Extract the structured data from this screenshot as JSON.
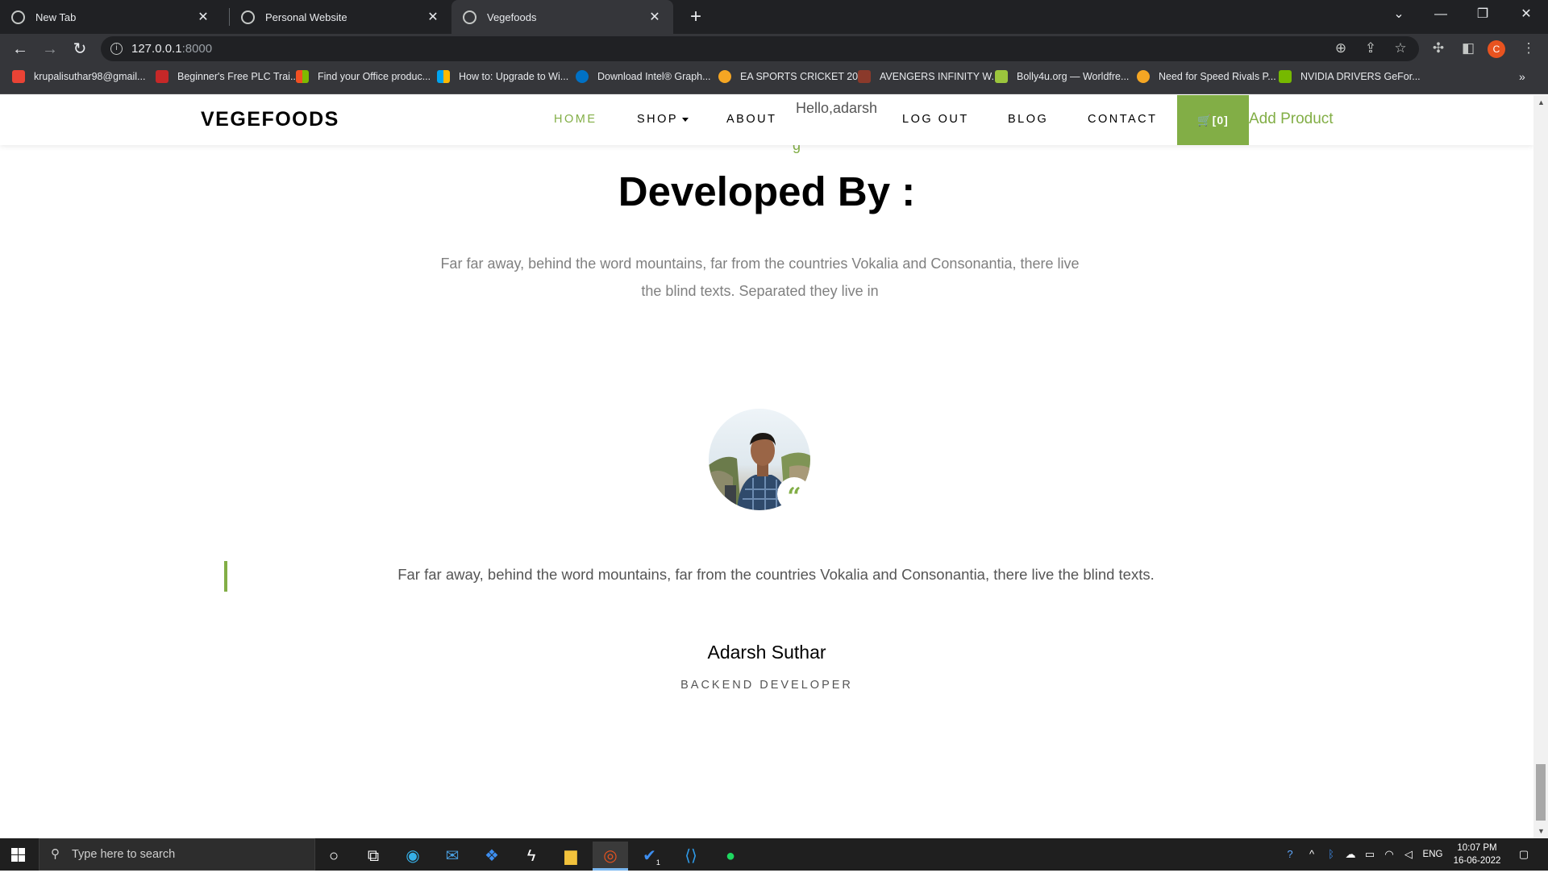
{
  "browser": {
    "tabs": [
      {
        "title": "New Tab"
      },
      {
        "title": "Personal Website"
      },
      {
        "title": "Vegefoods"
      }
    ],
    "url_host": "127.0.0.1",
    "url_port": ":8000",
    "profile_initial": "C",
    "bookmarks": [
      {
        "label": "krupalisuthar98@gmail...",
        "color": "#ea4335"
      },
      {
        "label": "Beginner's Free PLC Trai...",
        "color": "#c62828"
      },
      {
        "label": "Find your Office produc...",
        "color": "#f25022"
      },
      {
        "label": "How to: Upgrade to Wi...",
        "color": "#00a4ef"
      },
      {
        "label": "Download Intel® Graph...",
        "color": "#0071c5"
      },
      {
        "label": "EA SPORTS CRICKET 20...",
        "color": "#f5a623"
      },
      {
        "label": "AVENGERS INFINITY W...",
        "color": "#8b3a2b"
      },
      {
        "label": "Bolly4u.org — Worldfre...",
        "color": "#9bc53d"
      },
      {
        "label": "Need for Speed Rivals P...",
        "color": "#f5a623"
      },
      {
        "label": "NVIDIA DRIVERS GeFor...",
        "color": "#76b900"
      }
    ]
  },
  "site": {
    "brand": "VEGEFOODS",
    "nav": {
      "home": "HOME",
      "shop": "SHOP",
      "about": "ABOUT",
      "hello": "Hello,adarsh",
      "logout": "LOG OUT",
      "blog": "BLOG",
      "contact": "CONTACT",
      "cart": "[0]",
      "add_product": "Add Product"
    },
    "accent_color": "#82ae46",
    "peek_text": "g",
    "heading": "Developed By :",
    "intro": "Far far away, behind the word mountains, far from the countries Vokalia and Consonantia, there live the blind texts. Separated they live in",
    "quote_mark": "“",
    "testimonial": "Far far away, behind the word mountains, far from the countries Vokalia and Consonantia, there live the blind texts.",
    "person_name": "Adarsh Suthar",
    "person_role": "BACKEND DEVELOPER"
  },
  "taskbar": {
    "search_placeholder": "Type here to search",
    "language": "ENG",
    "time": "10:07 PM",
    "date": "16-06-2022",
    "badge": "1"
  }
}
